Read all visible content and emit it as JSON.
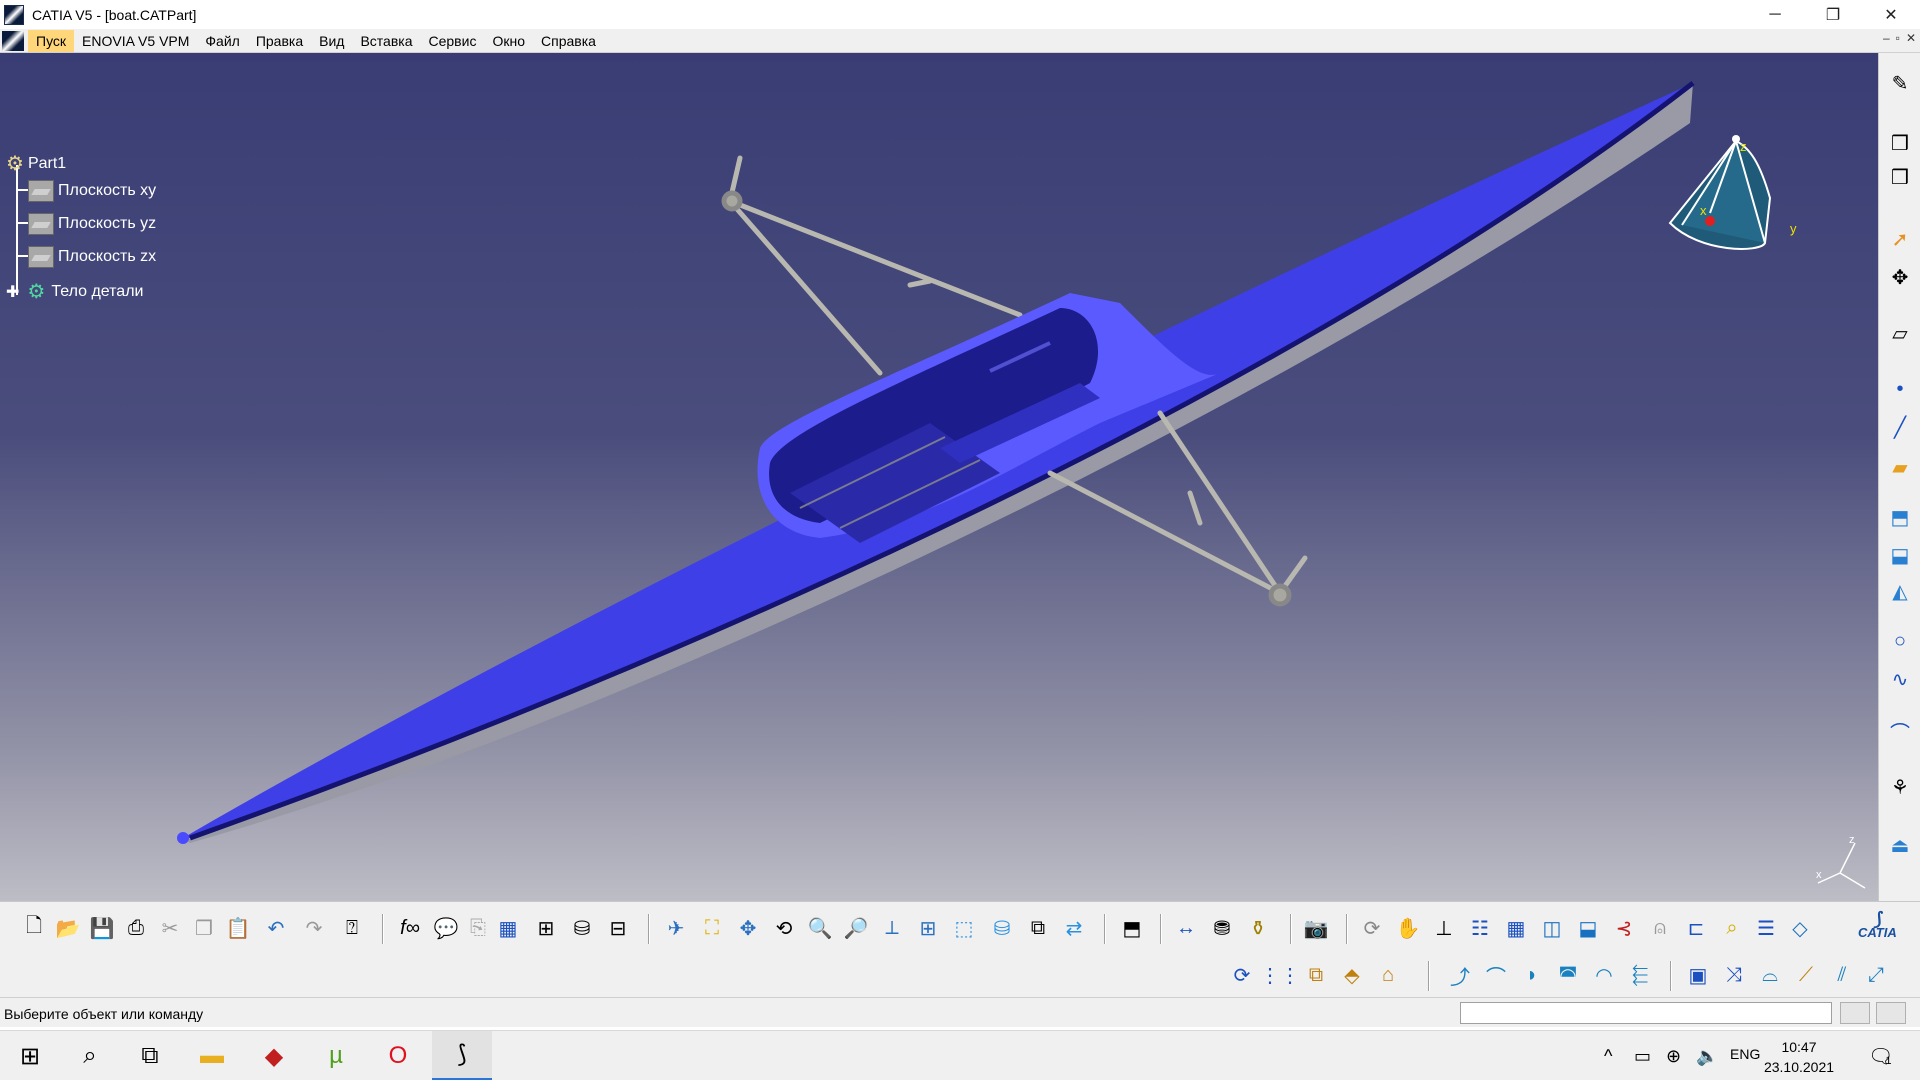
{
  "window": {
    "title": "CATIA V5 - [boat.CATPart]",
    "minimize": "─",
    "restore": "❐",
    "close": "✕"
  },
  "menu": {
    "items": [
      "Пуск",
      "ENOVIA V5 VPM",
      "Файл",
      "Правка",
      "Вид",
      "Вставка",
      "Сервис",
      "Окно",
      "Справка"
    ],
    "active": "Пуск",
    "mdi": [
      "–",
      "▫",
      "✕"
    ]
  },
  "spec_tree": {
    "root": "Part1",
    "planes": [
      "Плоскость xy",
      "Плоскость yz",
      "Плоскость zx"
    ],
    "body": "Тело детали"
  },
  "compass": {
    "x": "x",
    "y": "y",
    "z": "z"
  },
  "axis_triad": {
    "z": "z",
    "x": "x"
  },
  "colors": {
    "hull": "#3f3fe8",
    "hull_dark": "#1a1a8a",
    "hull_bottom": "#9a9aa6",
    "rigger": "#b8b8b0",
    "viewport_top": "#393d74",
    "viewport_bottom": "#bdbdc6",
    "menu_active": "#ffd77a"
  },
  "right_toolbar_icons": [
    "sketcher-icon",
    "chevron-icon",
    "select-icon",
    "snap-icon",
    "sketch-icon",
    "point-icon",
    "line-icon",
    "plane-icon",
    "extrude-icon",
    "revolve-icon",
    "sweep-icon",
    "circle-icon",
    "spline-icon",
    "curve-icon",
    "analysis-icon",
    "measure-icon"
  ],
  "toolbar1_icons": [
    "new-icon",
    "open-icon",
    "save-icon",
    "print-icon",
    "cut-icon",
    "copy-icon",
    "paste-icon",
    "undo-icon",
    "redo-icon",
    "help-icon",
    "formula-icon",
    "comment-icon",
    "clip-icon",
    "table-icon",
    "tree-icon",
    "catalog-icon",
    "knowledge-icon",
    "fly-icon",
    "fit-all-icon",
    "pan-icon",
    "rotate-icon",
    "zoom-in-icon",
    "zoom-out-icon",
    "normal-view-icon",
    "multi-view-icon",
    "iso-view-icon",
    "shading-icon",
    "hide-show-icon",
    "swap-icon",
    "apply-material-icon",
    "measure-between-icon",
    "measure-item-icon",
    "measure-inertia-icon",
    "capture-icon",
    "update-icon",
    "hand-icon",
    "axis-icon",
    "planes-icon",
    "grid-icon",
    "surface-icon",
    "solid-icon",
    "constraint-icon",
    "multi-section-icon",
    "analysis-icon",
    "list-icon",
    "tessellate-icon",
    "catia-logo-icon"
  ],
  "catia_logo": "CATIA",
  "toolbar2_icons": [
    "repeat-icon",
    "grid-points-icon",
    "pattern-icon",
    "boolean-icon",
    "extract-icon",
    "join-icon",
    "healing-icon",
    "untrim-icon",
    "offset-icon",
    "fill-icon",
    "blend-icon",
    "projection-icon",
    "intersect-icon",
    "fillet-icon",
    "trim-icon",
    "split-icon",
    "transform-icon"
  ],
  "status": {
    "text": "Выберите объект или команду",
    "input_value": ""
  },
  "taskbar": {
    "apps": [
      "windows-start-icon",
      "search-icon",
      "task-view-icon",
      "explorer-icon",
      "app-red-icon",
      "utorrent-icon",
      "opera-icon",
      "catia-icon"
    ],
    "lang": "ENG",
    "time": "10:47",
    "date": "23.10.2021",
    "notification_count": "1"
  }
}
